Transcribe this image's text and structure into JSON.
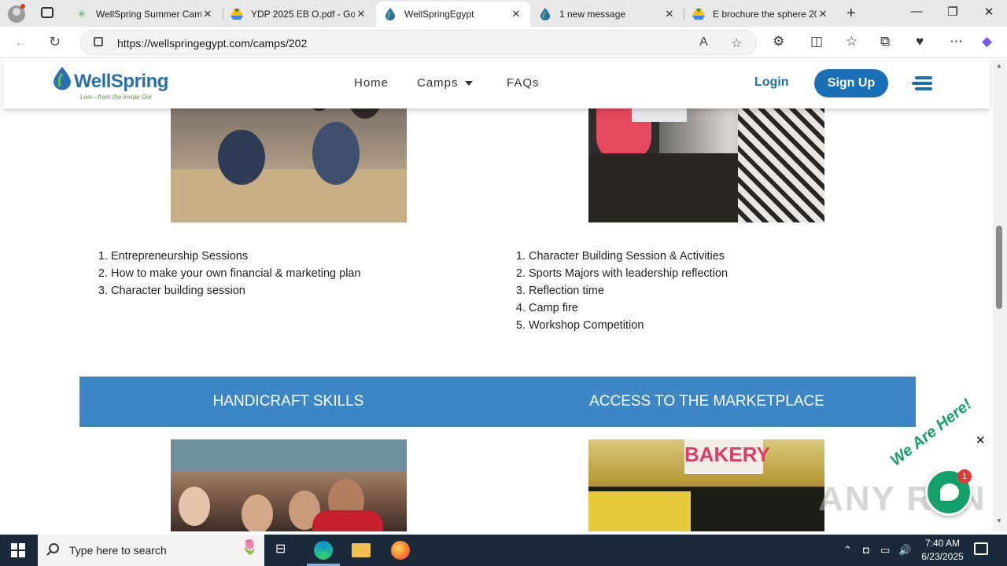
{
  "browser": {
    "tabs": [
      {
        "title": "WellSpring Summer Camp",
        "favicon": "green-star-icon",
        "active": false
      },
      {
        "title": "YDP 2025 EB O.pdf - Goo",
        "favicon": "google-drive-icon",
        "active": false
      },
      {
        "title": "WellSpringEgypt",
        "favicon": "wellspring-drop-icon",
        "active": true
      },
      {
        "title": "1 new message",
        "favicon": "wellspring-drop-icon",
        "active": false
      },
      {
        "title": "E brochure the sphere 20",
        "favicon": "google-drive-icon",
        "active": false
      }
    ],
    "url": "https://wellspringegypt.com/camps/202",
    "url_host": "wellspringegypt.com",
    "url_prefix": "https://",
    "url_path": "/camps/202"
  },
  "site": {
    "logo_text": "WellSpring",
    "logo_tagline": "Live—from the Inside Out",
    "nav": {
      "home": "Home",
      "camps": "Camps",
      "faqs": "FAQs",
      "login": "Login",
      "signup": "Sign Up"
    },
    "colors": {
      "brand_blue": "#1a6fb5",
      "banner_blue": "#3d86c6",
      "logo_green": "#5a9a3a"
    }
  },
  "content": {
    "left_list": [
      "Entrepreneurship Sessions",
      "How to make your own financial & marketing plan",
      "Character building session"
    ],
    "right_list": [
      "Character Building Session & Activities",
      " Sports Majors with leadership reflection",
      "Reflection time",
      "Camp fire",
      "Workshop Competition"
    ],
    "banner_left": "HANDICRAFT SKILLS",
    "banner_right": "ACCESS TO THE MARKETPLACE",
    "bakery_sign": "BAKERY"
  },
  "chat_widget": {
    "label": "We Are Here!",
    "badge_count": "1",
    "close": "✕"
  },
  "watermark": "ANY RUN",
  "taskbar": {
    "search_placeholder": "Type here to search",
    "time": "7:40 AM",
    "date": "6/23/2025"
  }
}
